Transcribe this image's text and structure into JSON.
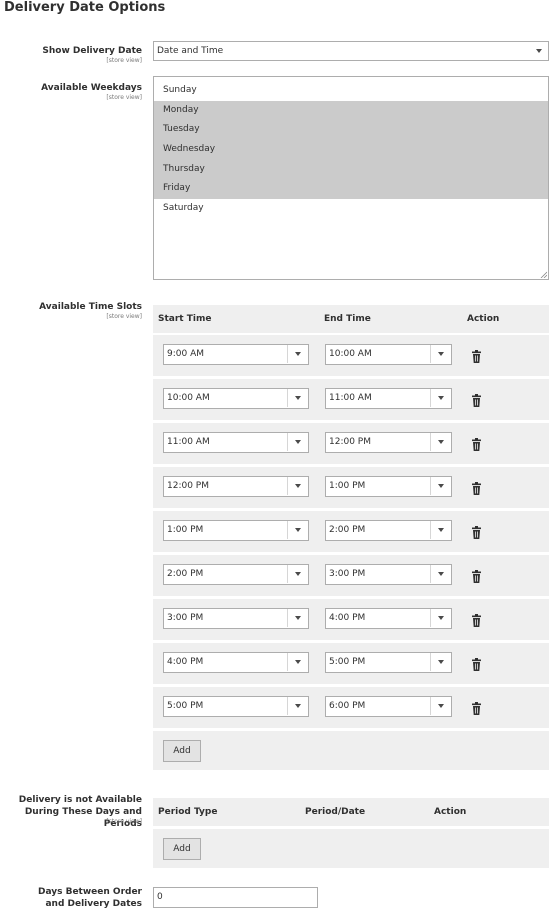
{
  "section_title": "Delivery Date Options",
  "show_delivery_date": {
    "label": "Show Delivery Date",
    "scope": "[store view]",
    "value": "Date and Time"
  },
  "weekdays": {
    "label": "Available Weekdays",
    "scope": "[store view]",
    "options": [
      {
        "label": "Sunday",
        "selected": false
      },
      {
        "label": "Monday",
        "selected": true
      },
      {
        "label": "Tuesday",
        "selected": true
      },
      {
        "label": "Wednesday",
        "selected": true
      },
      {
        "label": "Thursday",
        "selected": true
      },
      {
        "label": "Friday",
        "selected": true
      },
      {
        "label": "Saturday",
        "selected": false
      }
    ]
  },
  "time_slots": {
    "label": "Available Time Slots",
    "scope": "[store view]",
    "headers": {
      "start": "Start Time",
      "end": "End Time",
      "action": "Action"
    },
    "rows": [
      {
        "start": "9:00 AM",
        "end": "10:00 AM"
      },
      {
        "start": "10:00 AM",
        "end": "11:00 AM"
      },
      {
        "start": "11:00 AM",
        "end": "12:00 PM"
      },
      {
        "start": "12:00 PM",
        "end": "1:00 PM"
      },
      {
        "start": "1:00 PM",
        "end": "2:00 PM"
      },
      {
        "start": "2:00 PM",
        "end": "3:00 PM"
      },
      {
        "start": "3:00 PM",
        "end": "4:00 PM"
      },
      {
        "start": "4:00 PM",
        "end": "5:00 PM"
      },
      {
        "start": "5:00 PM",
        "end": "6:00 PM"
      }
    ],
    "add_label": "Add",
    "delete_icon": "trash-icon"
  },
  "unavailable": {
    "label_line1": "Delivery is not Available",
    "label_line2": "During These Days and Periods",
    "scope": "[store view]",
    "headers": {
      "type": "Period Type",
      "date": "Period/Date",
      "action": "Action"
    },
    "add_label": "Add"
  },
  "days_between": {
    "label_line1": "Days Between Order",
    "label_line2": "and Delivery Dates",
    "value": "0"
  },
  "colors": {
    "selected_option_bg": "#cbcbcb",
    "panel_bg": "#efefef",
    "border": "#adadad"
  }
}
